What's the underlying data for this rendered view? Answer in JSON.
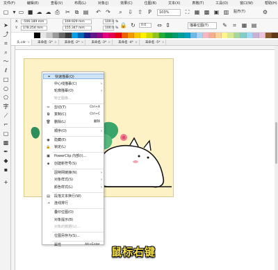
{
  "menubar": [
    "文件(F)",
    "编辑(E)",
    "查看(V)",
    "布局(L)",
    "对象(J)",
    "效果(C)",
    "位图(B)",
    "文本(X)",
    "表格(T)",
    "工具(O)",
    "窗口(W)",
    "帮助(H)"
  ],
  "toolbar": {
    "zoom": "103%",
    "snap_label": "贴齐(T)"
  },
  "propbar": {
    "x_label": "X:",
    "x_value": "-506.189 mm",
    "y_label": "Y:",
    "y_value": "178.254 mm",
    "w_value": "169.929 mm",
    "h_value": "155.347 mm",
    "sx": "100.0",
    "sy": "100.0",
    "pct": "%",
    "angle": "0.0",
    "bracket_label": "描摹位图(T)"
  },
  "tabs": [
    "头.cdr",
    "未命名 -1*",
    "未命名 -2*",
    "未命名 -3*",
    "未命名 -4*",
    "未命名 -5*"
  ],
  "palette": [
    "#ffffff",
    "#000000",
    "#e6e6e6",
    "#c8c8c8",
    "#999999",
    "#666666",
    "#3a3a3a",
    "#00a0e9",
    "#0068b7",
    "#1d2088",
    "#601986",
    "#920783",
    "#e4007f",
    "#e5004f",
    "#e60012",
    "#eb6100",
    "#f39800",
    "#fcc800",
    "#fff100",
    "#cfdb00",
    "#8fc31f",
    "#22ac38",
    "#009944",
    "#009b6b",
    "#009e96",
    "#00a0c1",
    "#6fb8e6",
    "#a5d4f3",
    "#f8b6c3",
    "#f6ad8d",
    "#fbd39a",
    "#fff58c",
    "#d5e893",
    "#a6d6a0",
    "#84ccc9",
    "#9fd9f6",
    "#c7b2d6",
    "#e9c5dc",
    "#8b5a2b",
    "#5c3a1a"
  ],
  "context_menu": {
    "items": [
      {
        "label": "快速描摹(Q)",
        "icon": "quick-trace-icon",
        "highlight": true
      },
      {
        "label": "中心线描摹(C)",
        "arrow": true
      },
      {
        "label": "轮廓描摹(O)",
        "arrow": true
      },
      {
        "label": "矫正图像...",
        "disabled": true
      },
      {
        "label": "剪切(T)",
        "shortcut": "Ctrl+X",
        "icon": "cut-icon"
      },
      {
        "label": "复制(C)",
        "shortcut": "Ctrl+C",
        "icon": "copy-icon"
      },
      {
        "label": "删除(L)",
        "shortcut": "删除",
        "icon": "delete-icon"
      },
      {
        "label": "顺序(O)",
        "arrow": true
      },
      {
        "label": "隐藏(E)",
        "icon": "hide-icon"
      },
      {
        "label": "锁定(L)",
        "icon": "lock-icon"
      },
      {
        "label": "PowerClip 内部(I)...",
        "icon": "powerclip-icon"
      },
      {
        "label": "创建新符号(S)",
        "icon": "symbol-icon"
      },
      {
        "label": "因特网链接(N)",
        "arrow": true
      },
      {
        "label": "对象样式(S)",
        "arrow": true
      },
      {
        "label": "颜色样式(L)",
        "arrow": true
      },
      {
        "label": "段落文本换行(W)",
        "icon": "wrap-icon"
      },
      {
        "label": "连线排行",
        "icon": "link-icon"
      },
      {
        "label": "叠印位图(O)"
      },
      {
        "label": "对象提示(B)"
      },
      {
        "label": "对象的数据(U)...",
        "disabled": true
      },
      {
        "label": "位图另存为(S)..."
      },
      {
        "label": "属性",
        "shortcut": "Alt+Enter"
      }
    ]
  },
  "caption": "鼠标右键",
  "colors": {
    "page_bg": "#fdf2c5",
    "highlight": "#cfe3f6",
    "caption": "#f7e14a"
  }
}
